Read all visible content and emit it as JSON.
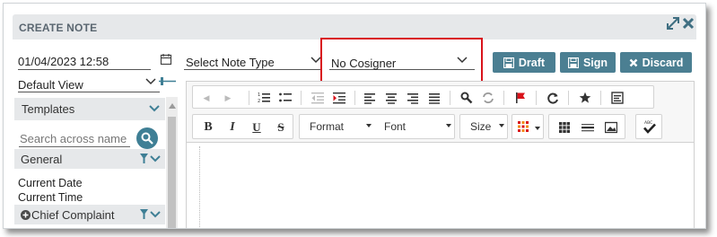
{
  "window": {
    "title": "CREATE NOTE",
    "icons": [
      "expand-icon",
      "close-icon"
    ]
  },
  "left": {
    "datetime_value": "01/04/2023 12:58",
    "view_value": "Default View",
    "templates_label": "Templates",
    "search_placeholder": "Search across name",
    "group_label": "General",
    "items": [
      "Current Date",
      "Current Time"
    ],
    "chief_complaint_label": "Chief Complaint"
  },
  "fields": {
    "note_type_placeholder": "Select Note Type",
    "cosigner_value": "No Cosigner"
  },
  "actions": {
    "draft_label": "Draft",
    "sign_label": "Sign",
    "discard_label": "Discard"
  },
  "editor_toolbar": {
    "format_label": "Format",
    "font_label": "Font",
    "size_label": "Size",
    "bold": "B",
    "italic": "I",
    "underline": "U",
    "strike": "S"
  },
  "colors": {
    "accent": "#4b7f92",
    "highlight": "#d9131b",
    "header_bg": "#e6e8ea"
  }
}
